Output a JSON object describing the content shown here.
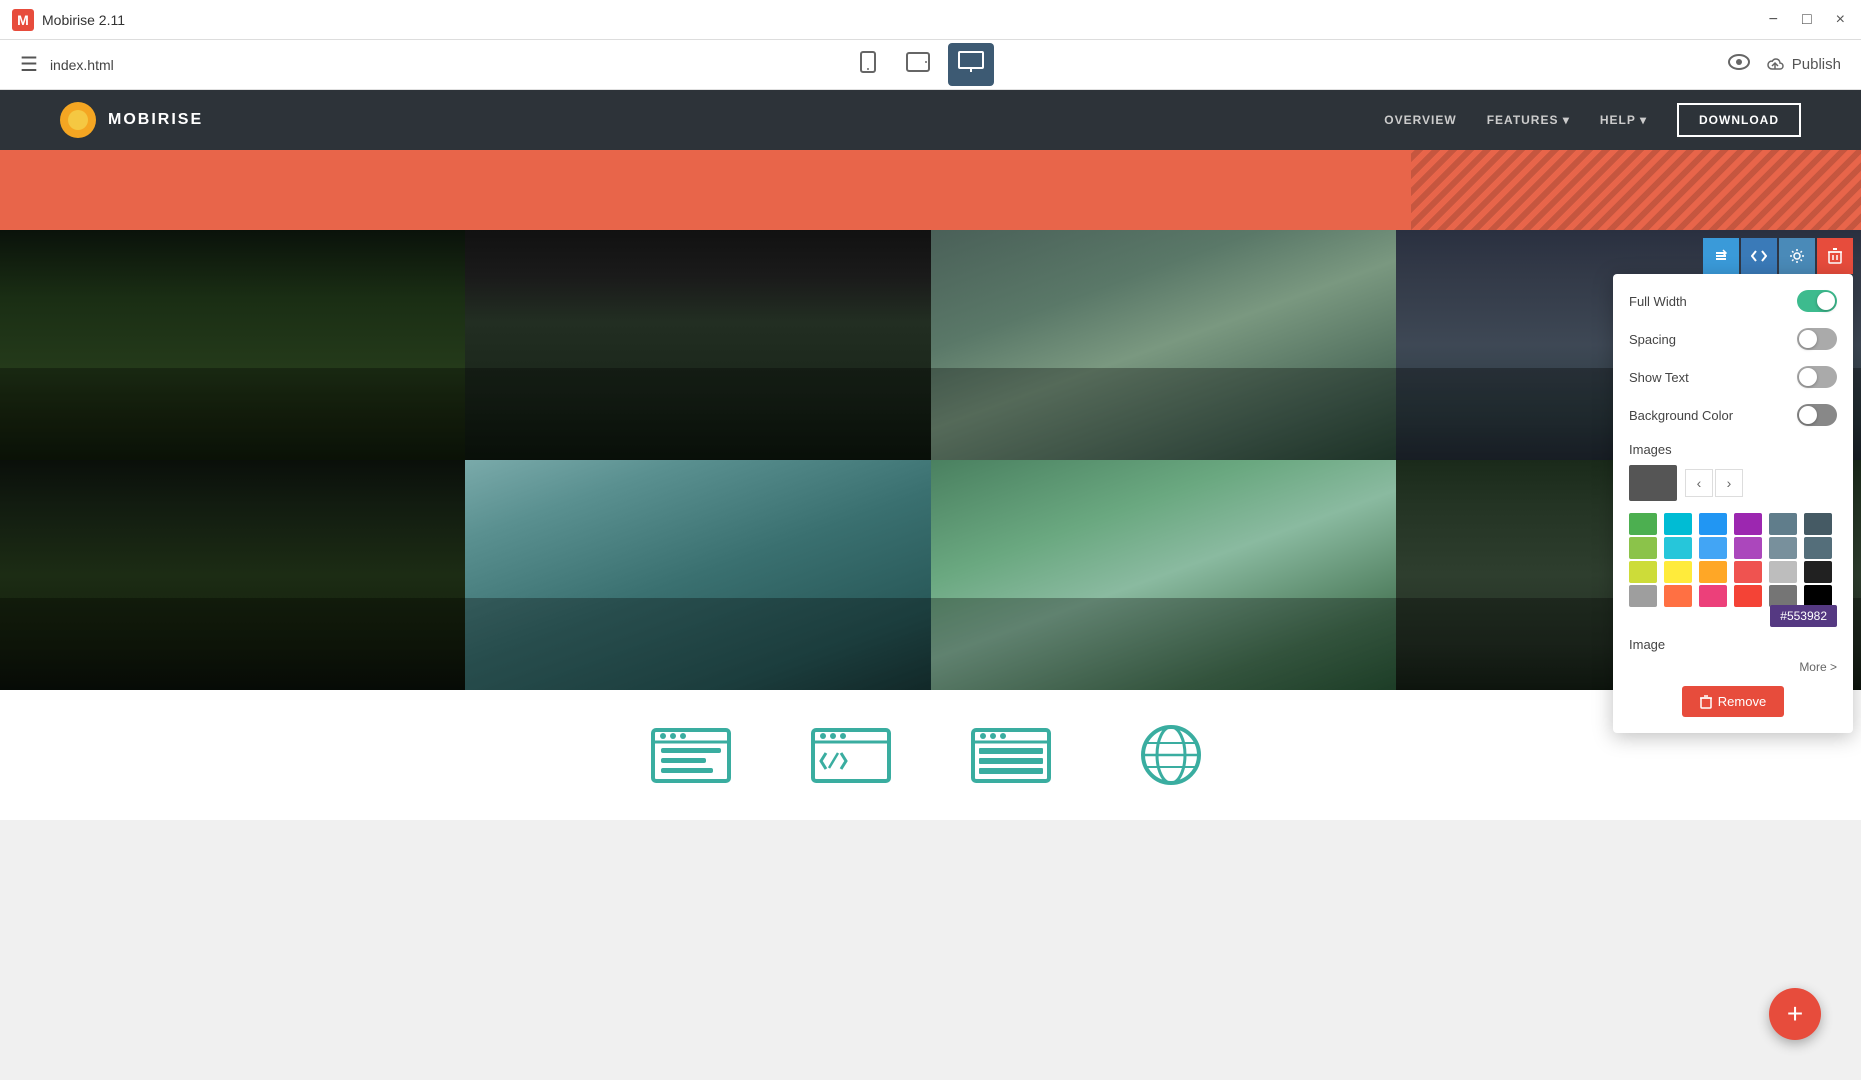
{
  "app": {
    "title": "Mobirise 2.11",
    "logo": "M"
  },
  "titlebar": {
    "title": "Mobirise 2.11",
    "minimize_label": "−",
    "maximize_label": "□",
    "close_label": "×"
  },
  "toolbar": {
    "file_name": "index.html",
    "mobile_icon": "📱",
    "tablet_icon": "⬜",
    "desktop_icon": "🖥",
    "preview_label": "👁",
    "publish_icon": "☁",
    "publish_label": "Publish"
  },
  "site_nav": {
    "brand": "MOBIRISE",
    "menu_items": [
      "OVERVIEW",
      "FEATURES ▾",
      "HELP ▾"
    ],
    "download_label": "DOWNLOAD"
  },
  "settings_panel": {
    "full_width_label": "Full Width",
    "full_width_on": true,
    "spacing_label": "Spacing",
    "spacing_on": false,
    "show_text_label": "Show Text",
    "show_text_on": false,
    "bg_color_label": "Background Color",
    "images_label": "Images",
    "image_label": "Image",
    "more_label": "More >",
    "color_hex": "#553982",
    "remove_label": "Remove",
    "colors": [
      "#4CAF50",
      "#00BCD4",
      "#2196F3",
      "#9C27B0",
      "#607D8B",
      "#455A64",
      "#8BC34A",
      "#26C6DA",
      "#42A5F5",
      "#AB47BC",
      "#78909C",
      "#546E7A",
      "#CDDC39",
      "#FFEB3B",
      "#FFA726",
      "#EF5350",
      "#BDBDBD",
      "#212121",
      "#9E9E9E",
      "#FF7043",
      "#EC407A",
      "#F44336",
      "#757575",
      "#000000"
    ]
  },
  "section_controls": {
    "reorder_icon": "⇅",
    "code_icon": "</>",
    "gear_icon": "⚙",
    "delete_icon": "🗑"
  },
  "fab": {
    "label": "+"
  }
}
